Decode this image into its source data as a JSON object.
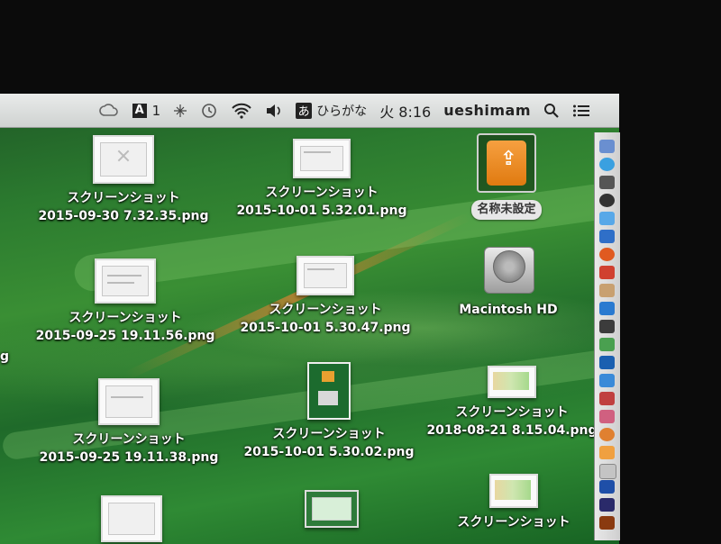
{
  "menubar": {
    "adobe_count": "1",
    "ime_glyph": "あ",
    "ime_label": "ひらがな",
    "clock": "火 8:16",
    "user": "ueshimam"
  },
  "desktop": {
    "items": [
      {
        "name": "スクリーンショット",
        "file": "2015-09-30 7.32.35.png"
      },
      {
        "name": "スクリーンショット",
        "file": "2015-10-01 5.32.01.png"
      },
      {
        "name": "名称未設定"
      },
      {
        "name": "スクリーンショット",
        "file": "2015-09-25 19.11.56.png"
      },
      {
        "name": "スクリーンショット",
        "file": "2015-10-01 5.30.47.png"
      },
      {
        "name": "Macintosh HD"
      },
      {
        "name": "スクリーンショット",
        "file": "2015-09-25 19.11.38.png"
      },
      {
        "name": "スクリーンショット",
        "file": "2015-10-01 5.30.02.png"
      },
      {
        "name": "スクリーンショット",
        "file": "2018-08-21 8.15.04.png"
      },
      {
        "name": "スクリーンショット"
      }
    ],
    "edge_fragment": "g"
  },
  "icons": {
    "menubar": [
      "creative-cloud-icon",
      "adobe-icon",
      "bluetooth-like-icon",
      "time-machine-icon",
      "wifi-icon",
      "volume-icon",
      "spotlight-icon",
      "notification-center-icon"
    ],
    "desktop": [
      "usb-drive-icon",
      "hard-drive-icon"
    ]
  },
  "colors": {
    "usb_drive": "#f08a1e",
    "menubar_bg": "#dfe1e0",
    "dock_bg": "#d9d9d9"
  }
}
